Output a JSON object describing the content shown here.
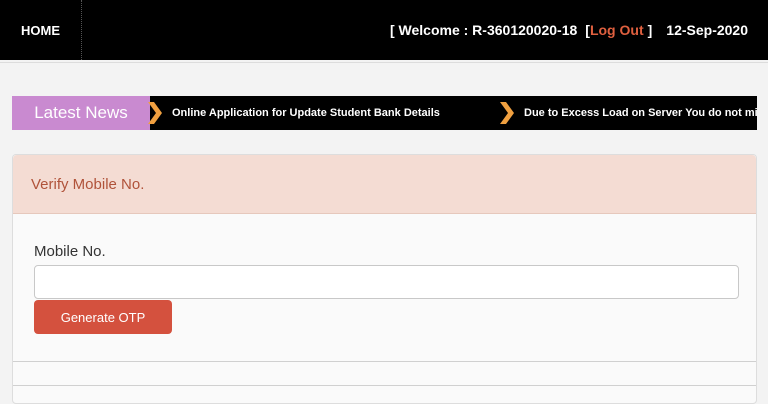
{
  "header": {
    "home_label": "HOME",
    "welcome_open": "[ Welcome : R-360120020-18 ",
    "logout_open": "[",
    "logout_label": "Log Out",
    "logout_close": "]",
    "date": "12-Sep-2020"
  },
  "news": {
    "label": "Latest News",
    "items": [
      "Online Application for Update Student Bank Details",
      "Due to Excess Load on Server You do not mis"
    ],
    "chevron_color": "#f0a040"
  },
  "panel": {
    "title": "Verify Mobile No.",
    "field_label": "Mobile No.",
    "field_value": "",
    "button_label": "Generate OTP"
  },
  "colors": {
    "accent_button": "#d4513e",
    "news_label_bg": "#c98ad0",
    "panel_header_bg": "#f4dcd3"
  }
}
